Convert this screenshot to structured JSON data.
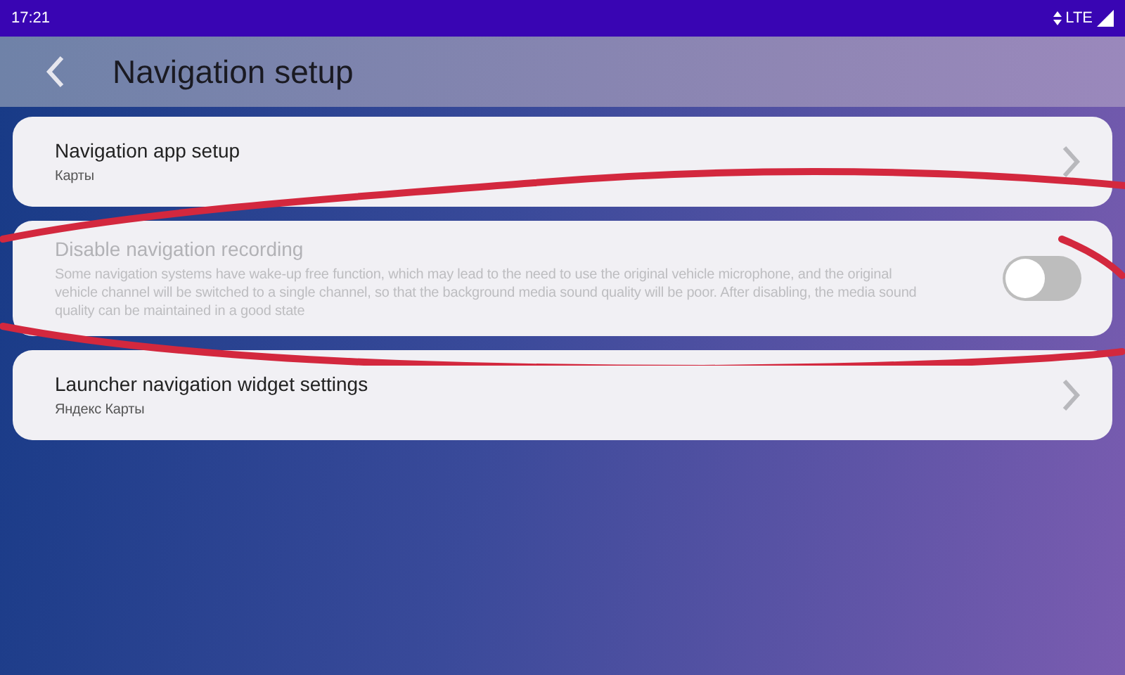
{
  "status_bar": {
    "time": "17:21",
    "network": "LTE"
  },
  "header": {
    "title": "Navigation setup"
  },
  "items": [
    {
      "kind": "link",
      "title": "Navigation app setup",
      "subtitle": "Карты",
      "disabled": false
    },
    {
      "kind": "switch",
      "title": "Disable navigation recording",
      "subtitle": "Some navigation systems have wake-up free function, which may lead to the need to use the original vehicle microphone, and the original vehicle channel will be switched to a single channel, so that the background media sound quality will be poor. After disabling, the media sound quality can be maintained in a good state",
      "disabled": true,
      "on": false
    },
    {
      "kind": "link",
      "title": "Launcher navigation widget settings",
      "subtitle": "Яндекс Карты",
      "disabled": false
    }
  ]
}
